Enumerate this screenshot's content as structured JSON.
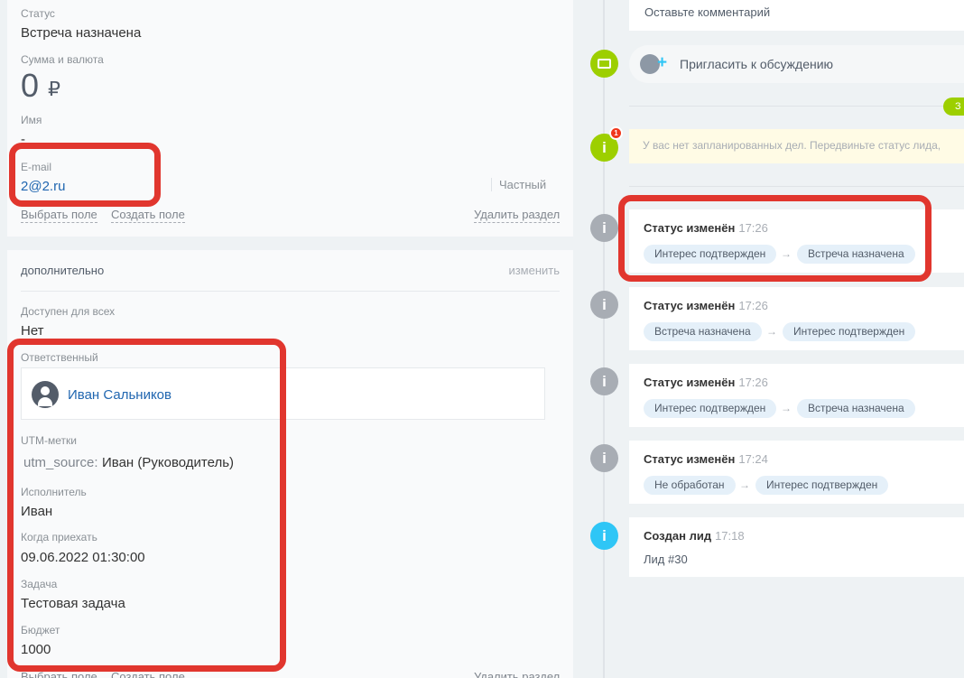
{
  "left": {
    "status": {
      "label": "Статус",
      "value": "Встреча назначена"
    },
    "sum": {
      "label": "Сумма и валюта",
      "amount": "0",
      "currency": "₽"
    },
    "name": {
      "label": "Имя",
      "value": "-"
    },
    "email": {
      "label": "E-mail",
      "value": "2@2.ru",
      "type": "Частный"
    },
    "actions": {
      "choose_field": "Выбрать поле",
      "create_field": "Создать поле",
      "delete_section": "Удалить раздел"
    },
    "extra": {
      "title": "дополнительно",
      "edit": "изменить",
      "available": {
        "label": "Доступен для всех",
        "value": "Нет"
      },
      "responsible": {
        "label": "Ответственный",
        "name": "Иван Сальников"
      },
      "utm": {
        "label": "UTM-метки",
        "key": "utm_source:",
        "value": "Иван (Руководитель)"
      },
      "executor": {
        "label": "Исполнитель",
        "value": "Иван"
      },
      "arrival": {
        "label": "Когда приехать",
        "value": "09.06.2022 01:30:00"
      },
      "task": {
        "label": "Задача",
        "value": "Тестовая задача"
      },
      "budget": {
        "label": "Бюджет",
        "value": "1000"
      }
    }
  },
  "timeline": {
    "comment_placeholder": "Оставьте комментарий",
    "invite": "Пригласить к обсуждению",
    "pill": "З",
    "badge_count": "1",
    "notice": "У вас нет запланированных дел. Передвиньте статус лида,",
    "events": [
      {
        "title": "Статус изменён",
        "time": "17:26",
        "from": "Интерес подтвержден",
        "to": "Встреча назначена"
      },
      {
        "title": "Статус изменён",
        "time": "17:26",
        "from": "Встреча назначена",
        "to": "Интерес подтвержден"
      },
      {
        "title": "Статус изменён",
        "time": "17:26",
        "from": "Интерес подтвержден",
        "to": "Встреча назначена"
      },
      {
        "title": "Статус изменён",
        "time": "17:24",
        "from": "Не обработан",
        "to": "Интерес подтвержден"
      }
    ],
    "created": {
      "title": "Создан лид",
      "time": "17:18",
      "sub": "Лид #30"
    }
  },
  "colors": {
    "highlight": "#e1362e",
    "link": "#2066b0",
    "green": "#9dcf00",
    "info_blue": "#2fc6f6"
  }
}
